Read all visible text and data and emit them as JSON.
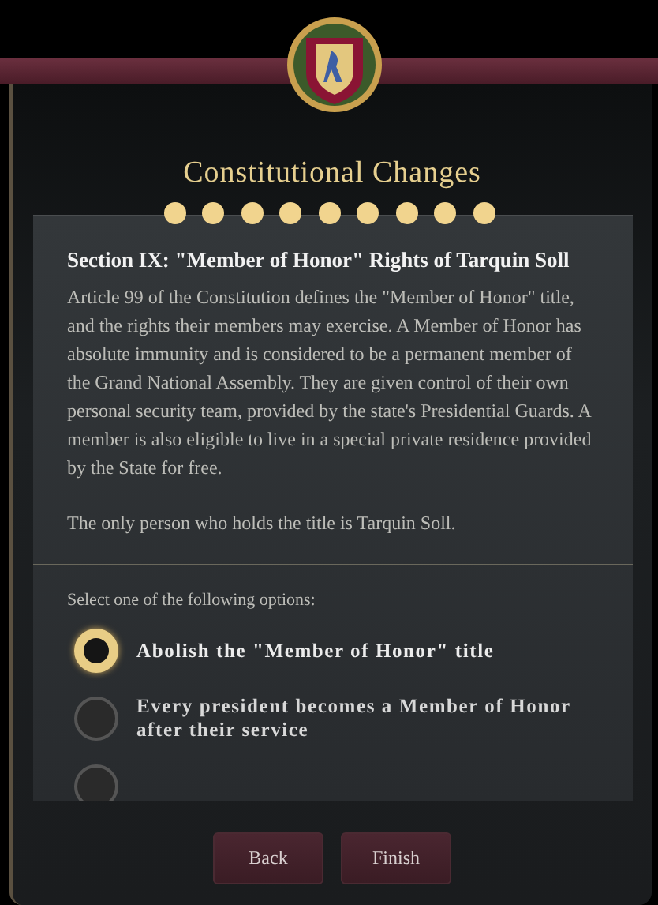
{
  "title": "Constitutional Changes",
  "progress": [
    {
      "done": true
    },
    {
      "done": true
    },
    {
      "done": true
    },
    {
      "done": true
    },
    {
      "done": true
    },
    {
      "done": true
    },
    {
      "done": true
    },
    {
      "done": true
    },
    {
      "done": true
    }
  ],
  "section": {
    "heading": "Section IX: \"Member of Honor\" Rights of Tarquin Soll",
    "paragraphs": [
      "Article 99 of the Constitution defines the \"Member of Honor\" title, and the rights their members may exercise. A Member of Honor has absolute immunity and is considered to be a permanent member of the Grand National Assembly. They are given control of their own personal security team, provided by the state's Presidential Guards. A member is also eligible to live in a special private residence provided by the State for free.",
      "The only person who holds the title is Tarquin Soll."
    ]
  },
  "prompt": "Select one of the following options:",
  "options": [
    {
      "label": "Abolish the \"Member of Honor\" title",
      "selected": true
    },
    {
      "label": "Every president becomes a Member of Honor after their service",
      "selected": false
    },
    {
      "selected": false
    }
  ],
  "buttons": [
    "Back",
    "Finish"
  ]
}
